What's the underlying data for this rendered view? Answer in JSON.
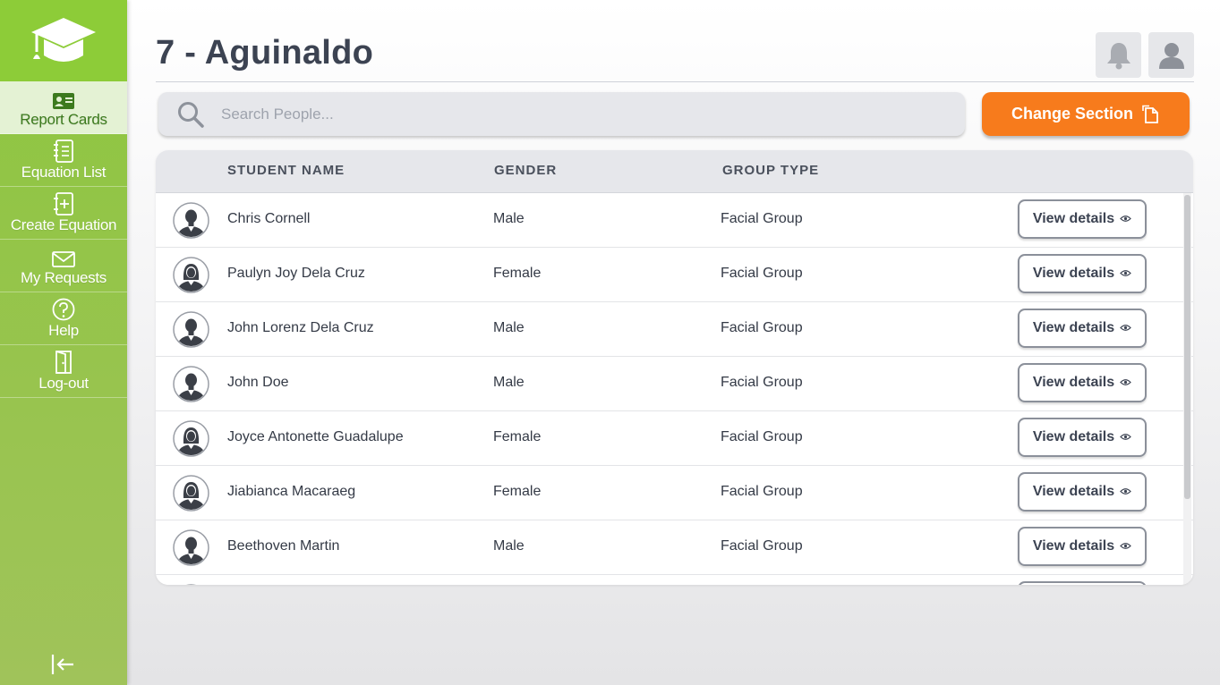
{
  "sidebar": {
    "logo_icon": "graduation-cap-icon",
    "items": [
      {
        "label": "Report Cards",
        "icon": "id-card-icon",
        "active": true
      },
      {
        "label": "Equation List",
        "icon": "notebook-icon",
        "active": false
      },
      {
        "label": "Create Equation",
        "icon": "add-document-icon",
        "active": false
      },
      {
        "label": "My Requests",
        "icon": "envelope-icon",
        "active": false
      },
      {
        "label": "Help",
        "icon": "question-icon",
        "active": false
      },
      {
        "label": "Log-out",
        "icon": "door-icon",
        "active": false
      }
    ],
    "collapse_icon": "collapse-left-icon"
  },
  "header": {
    "title": "7 - Aguinaldo",
    "notification_icon": "bell-icon",
    "profile_icon": "user-icon"
  },
  "search": {
    "placeholder": "Search People...",
    "value": ""
  },
  "change_section_button": {
    "label": "Change Section",
    "icon": "copy-document-icon"
  },
  "table": {
    "columns": [
      "STUDENT NAME",
      "GENDER",
      "GROUP TYPE"
    ],
    "action_label": "View details",
    "rows": [
      {
        "name": "Chris Cornell",
        "gender": "Male",
        "group": "Facial Group"
      },
      {
        "name": "Paulyn Joy Dela Cruz",
        "gender": "Female",
        "group": "Facial Group"
      },
      {
        "name": "John Lorenz Dela Cruz",
        "gender": "Male",
        "group": "Facial Group"
      },
      {
        "name": "John Doe",
        "gender": "Male",
        "group": "Facial Group"
      },
      {
        "name": "Joyce Antonette Guadalupe",
        "gender": "Female",
        "group": "Facial Group"
      },
      {
        "name": "Jiabianca Macaraeg",
        "gender": "Female",
        "group": "Facial Group"
      },
      {
        "name": "Beethoven Martin",
        "gender": "Male",
        "group": "Facial Group"
      }
    ]
  },
  "colors": {
    "sidebar_green": "#8dc63f",
    "accent_orange": "#f77b1c",
    "title_text": "#3c4352"
  }
}
